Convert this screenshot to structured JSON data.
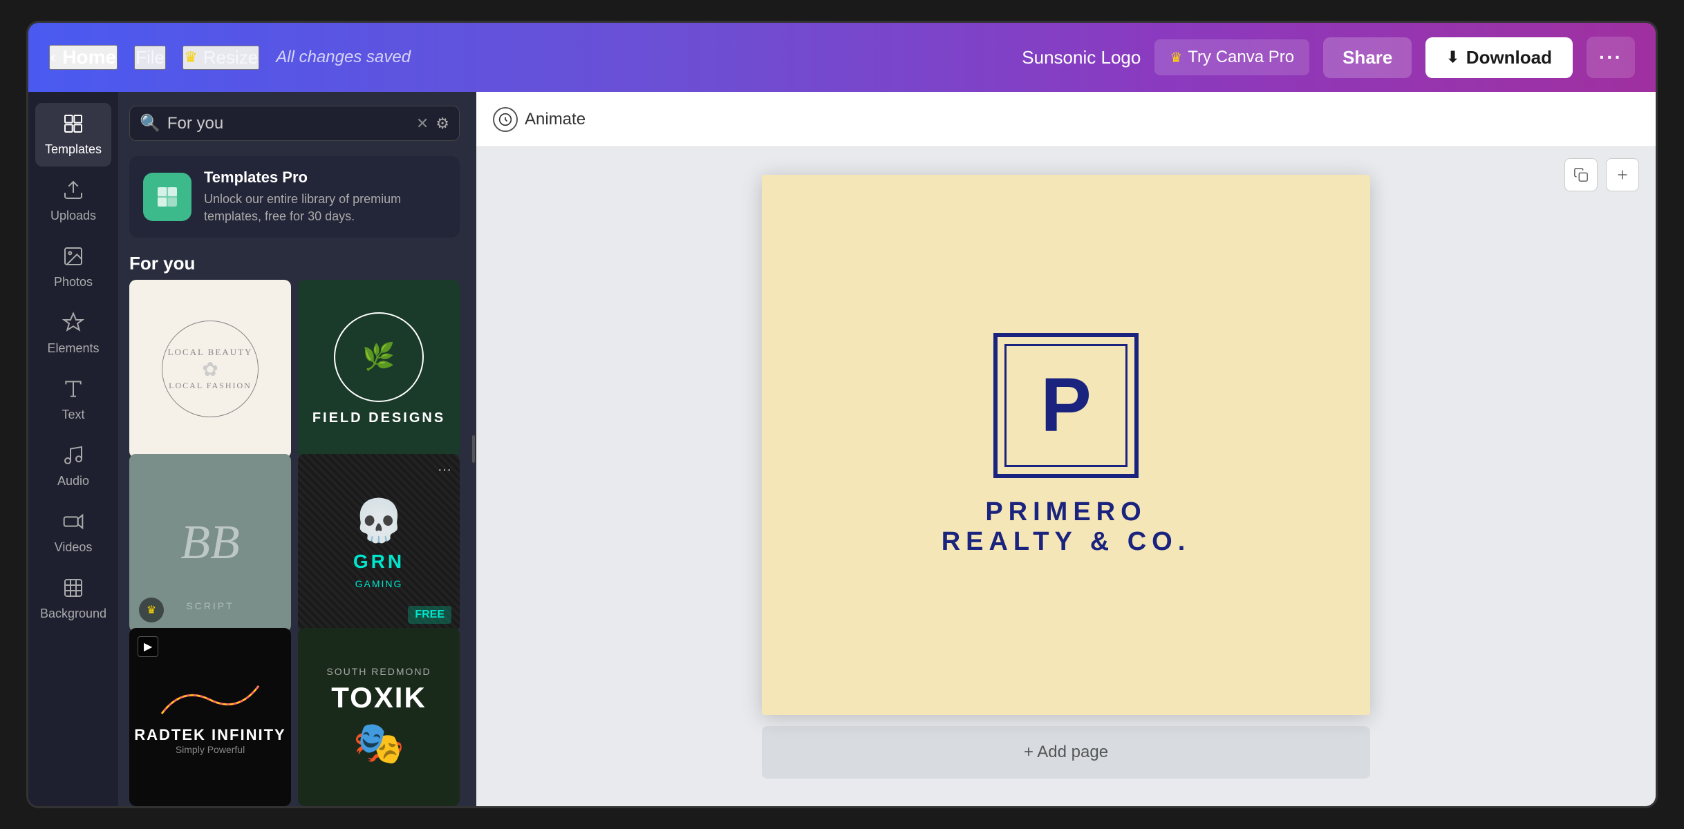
{
  "navbar": {
    "home_label": "Home",
    "file_label": "File",
    "resize_label": "Resize",
    "saved_text": "All changes saved",
    "project_name": "Sunsonic Logo",
    "try_canva_pro_label": "Try Canva Pro",
    "share_label": "Share",
    "download_label": "Download"
  },
  "sidebar": {
    "items": [
      {
        "id": "templates",
        "label": "Templates",
        "icon": "⊞"
      },
      {
        "id": "uploads",
        "label": "Uploads",
        "icon": "⬆"
      },
      {
        "id": "photos",
        "label": "Photos",
        "icon": "🖼"
      },
      {
        "id": "elements",
        "label": "Elements",
        "icon": "✦"
      },
      {
        "id": "text",
        "label": "Text",
        "icon": "T"
      },
      {
        "id": "audio",
        "label": "Audio",
        "icon": "♪"
      },
      {
        "id": "videos",
        "label": "Videos",
        "icon": "▶"
      },
      {
        "id": "background",
        "label": "Background",
        "icon": "▦"
      }
    ]
  },
  "templates_panel": {
    "search_placeholder": "For you",
    "search_value": "For you",
    "promo": {
      "title": "Templates Pro",
      "description": "Unlock our entire library of premium templates, free for 30 days."
    },
    "for_you_label": "For you",
    "templates": [
      {
        "id": "local-beauty",
        "alt": "Local Beauty Local Fashion"
      },
      {
        "id": "field-designs",
        "alt": "Field Designs",
        "label": "FIELD DESIGNS"
      },
      {
        "id": "bb",
        "alt": "BB Script Logo",
        "crown": true
      },
      {
        "id": "grn-gaming",
        "alt": "GRN Gaming",
        "label": "GRN",
        "sub": "GAMING",
        "free": true
      },
      {
        "id": "radtek",
        "alt": "Radtek Infinity",
        "label": "RADTEK INFINITY",
        "video": true
      },
      {
        "id": "toxik",
        "alt": "Toxik",
        "label": "TOXIK"
      }
    ]
  },
  "canvas": {
    "animate_label": "Animate",
    "design": {
      "company_line1": "PRIMERO",
      "company_line2": "REALTY & CO.",
      "p_letter": "P"
    },
    "add_page_label": "+ Add page"
  }
}
